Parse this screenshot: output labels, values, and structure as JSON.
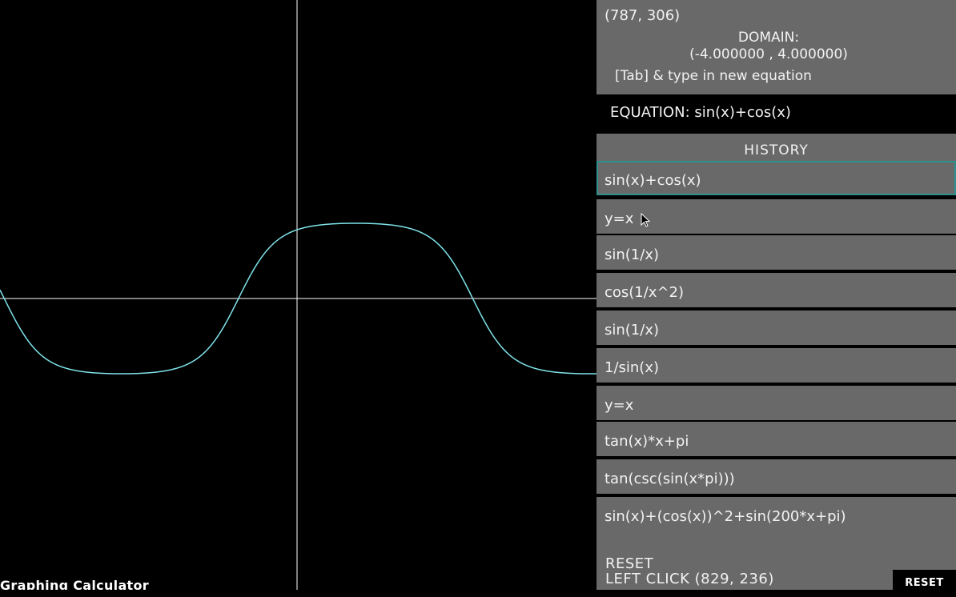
{
  "app": {
    "title": "Graphing Calculator"
  },
  "graph": {
    "equation": "sin(x)+cos(x)",
    "domain": [
      -4.0,
      4.0
    ],
    "curve_color": "#7fe3ea",
    "axis_color": "#ffffff",
    "background": "#000000"
  },
  "panel": {
    "coords": "(787, 306)",
    "domain_label": "DOMAIN:",
    "domain_value": "(-4.000000 , 4.000000)",
    "hint": "[Tab] & type in new equation",
    "equation_label": "EQUATION: sin(x)+cos(x)",
    "history_title": "HISTORY",
    "history": [
      "sin(x)+cos(x)",
      "y=x",
      "sin(1/x)",
      "cos(1/x^2)",
      "sin(1/x)",
      "1/sin(x)",
      "y=x",
      "tan(x)*x+pi",
      "tan(csc(sin(x*pi)))",
      "sin(x)+(cos(x))^2+sin(200*x+pi)"
    ],
    "reset_label": "RESET",
    "left_click": "LEFT CLICK (829, 236)",
    "reset_button": "RESET"
  },
  "colors": {
    "panel_bg": "#696969",
    "selected_border": "#2e8f8f"
  }
}
